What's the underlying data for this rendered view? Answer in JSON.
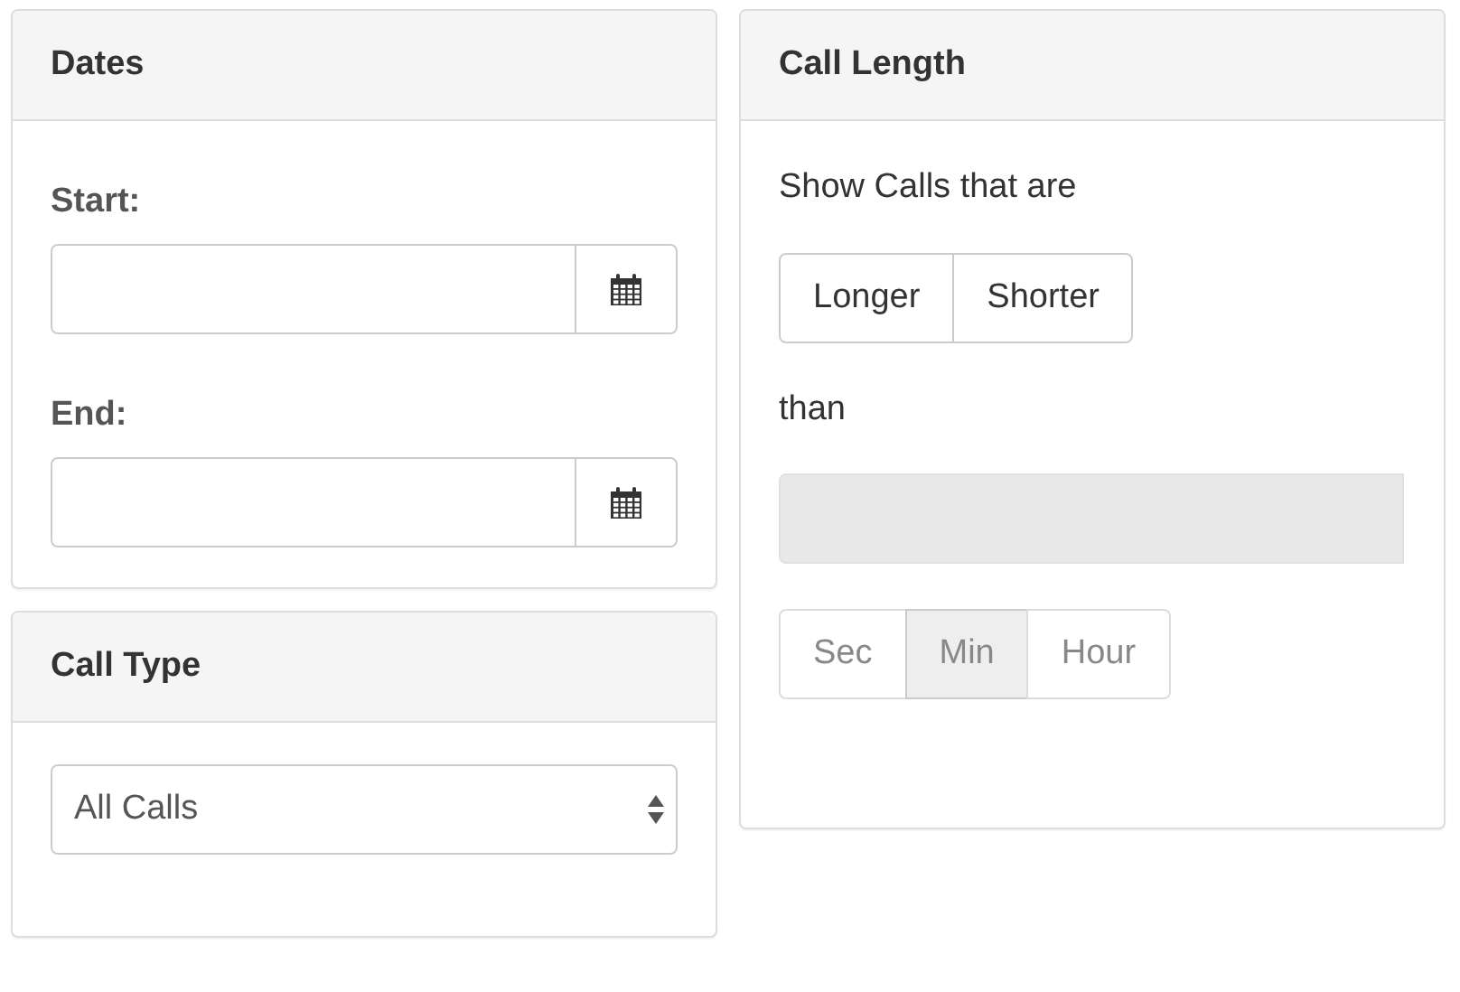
{
  "left_panels": [
    {
      "kind": "dates",
      "title": "Dates",
      "fields": [
        {
          "label": "Start:"
        },
        {
          "label": "End:"
        }
      ]
    },
    {
      "kind": "select",
      "title": "Call Type",
      "select": {
        "value": "All Calls"
      }
    }
  ],
  "call_length": {
    "title": "Call Length",
    "intro": "Show Calls that are",
    "directions": [
      {
        "label": "Longer",
        "selected": false
      },
      {
        "label": "Shorter",
        "selected": false
      }
    ],
    "connector": "than",
    "amount": {
      "disabled": true
    },
    "units": {
      "disabled": true,
      "options": [
        {
          "label": "Sec",
          "selected": false
        },
        {
          "label": "Min",
          "selected": true
        },
        {
          "label": "Hour",
          "selected": false
        }
      ]
    }
  }
}
